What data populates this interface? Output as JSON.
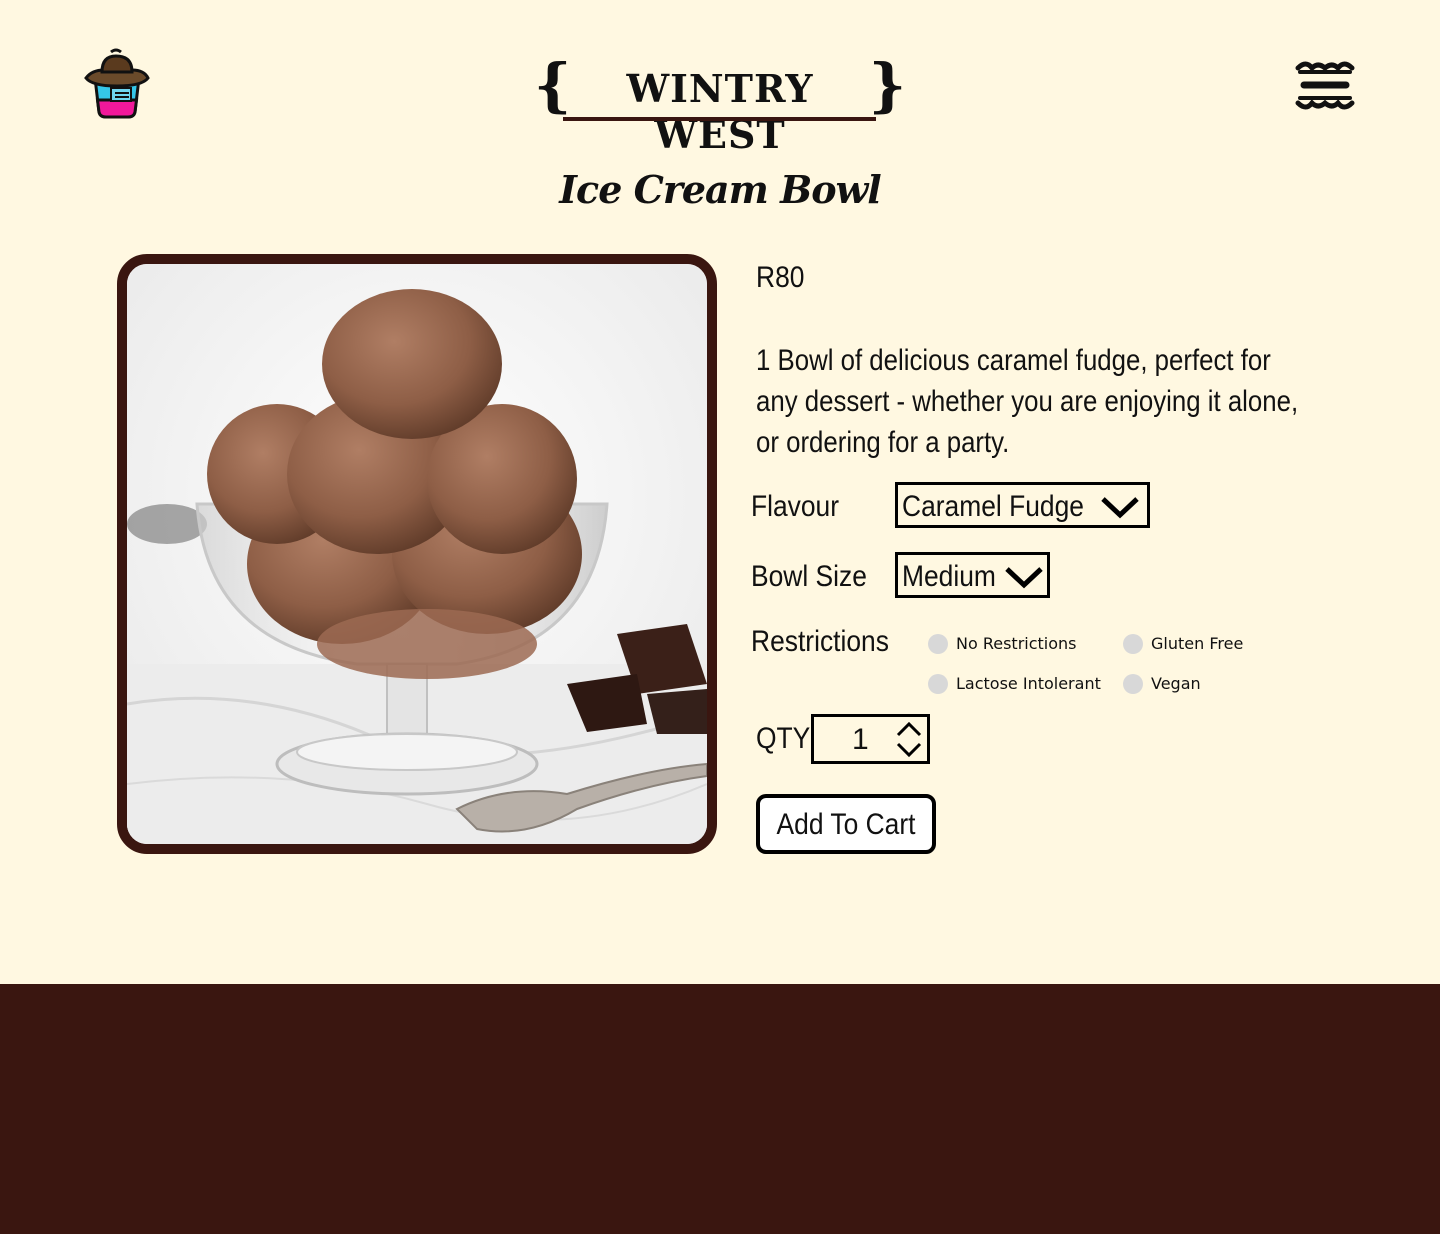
{
  "header": {
    "brand_name": "WINTRY WEST",
    "brand_left_brace": "{",
    "brand_right_brace": "}"
  },
  "product": {
    "title": "Ice Cream Bowl",
    "price": "R80",
    "description": "1 Bowl of delicious caramel fudge, perfect for any dessert - whether you are enjoying it alone, or ordering for a party."
  },
  "options": {
    "flavour_label": "Flavour",
    "flavour_value": "Caramel Fudge",
    "bowl_size_label": "Bowl Size",
    "bowl_size_value": "Medium",
    "restrictions_label": "Restrictions",
    "restrictions": [
      {
        "label": "No Restrictions"
      },
      {
        "label": "Gluten Free"
      },
      {
        "label": "Lactose Intolerant"
      },
      {
        "label": "Vegan"
      }
    ],
    "qty_label": "QTY",
    "qty_value": "1"
  },
  "actions": {
    "add_to_cart_label": "Add To Cart"
  },
  "colors": {
    "background": "#FFF8E1",
    "brand_brown": "#3A1610",
    "radio_grey": "#D8D8D8"
  }
}
